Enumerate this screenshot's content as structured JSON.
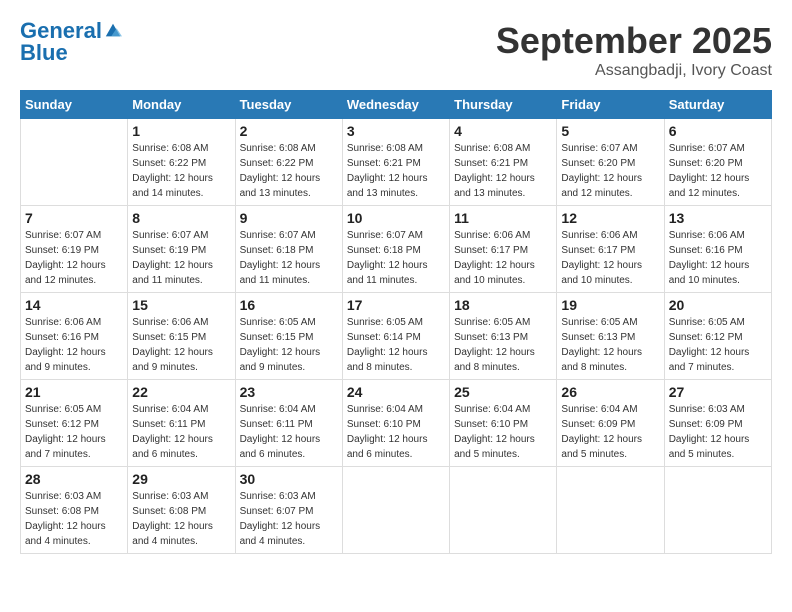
{
  "logo": {
    "line1": "General",
    "line2": "Blue"
  },
  "title": "September 2025",
  "location": "Assangbadji, Ivory Coast",
  "days_header": [
    "Sunday",
    "Monday",
    "Tuesday",
    "Wednesday",
    "Thursday",
    "Friday",
    "Saturday"
  ],
  "weeks": [
    [
      {
        "day": "",
        "info": ""
      },
      {
        "day": "1",
        "info": "Sunrise: 6:08 AM\nSunset: 6:22 PM\nDaylight: 12 hours\nand 14 minutes."
      },
      {
        "day": "2",
        "info": "Sunrise: 6:08 AM\nSunset: 6:22 PM\nDaylight: 12 hours\nand 13 minutes."
      },
      {
        "day": "3",
        "info": "Sunrise: 6:08 AM\nSunset: 6:21 PM\nDaylight: 12 hours\nand 13 minutes."
      },
      {
        "day": "4",
        "info": "Sunrise: 6:08 AM\nSunset: 6:21 PM\nDaylight: 12 hours\nand 13 minutes."
      },
      {
        "day": "5",
        "info": "Sunrise: 6:07 AM\nSunset: 6:20 PM\nDaylight: 12 hours\nand 12 minutes."
      },
      {
        "day": "6",
        "info": "Sunrise: 6:07 AM\nSunset: 6:20 PM\nDaylight: 12 hours\nand 12 minutes."
      }
    ],
    [
      {
        "day": "7",
        "info": "Sunrise: 6:07 AM\nSunset: 6:19 PM\nDaylight: 12 hours\nand 12 minutes."
      },
      {
        "day": "8",
        "info": "Sunrise: 6:07 AM\nSunset: 6:19 PM\nDaylight: 12 hours\nand 11 minutes."
      },
      {
        "day": "9",
        "info": "Sunrise: 6:07 AM\nSunset: 6:18 PM\nDaylight: 12 hours\nand 11 minutes."
      },
      {
        "day": "10",
        "info": "Sunrise: 6:07 AM\nSunset: 6:18 PM\nDaylight: 12 hours\nand 11 minutes."
      },
      {
        "day": "11",
        "info": "Sunrise: 6:06 AM\nSunset: 6:17 PM\nDaylight: 12 hours\nand 10 minutes."
      },
      {
        "day": "12",
        "info": "Sunrise: 6:06 AM\nSunset: 6:17 PM\nDaylight: 12 hours\nand 10 minutes."
      },
      {
        "day": "13",
        "info": "Sunrise: 6:06 AM\nSunset: 6:16 PM\nDaylight: 12 hours\nand 10 minutes."
      }
    ],
    [
      {
        "day": "14",
        "info": "Sunrise: 6:06 AM\nSunset: 6:16 PM\nDaylight: 12 hours\nand 9 minutes."
      },
      {
        "day": "15",
        "info": "Sunrise: 6:06 AM\nSunset: 6:15 PM\nDaylight: 12 hours\nand 9 minutes."
      },
      {
        "day": "16",
        "info": "Sunrise: 6:05 AM\nSunset: 6:15 PM\nDaylight: 12 hours\nand 9 minutes."
      },
      {
        "day": "17",
        "info": "Sunrise: 6:05 AM\nSunset: 6:14 PM\nDaylight: 12 hours\nand 8 minutes."
      },
      {
        "day": "18",
        "info": "Sunrise: 6:05 AM\nSunset: 6:13 PM\nDaylight: 12 hours\nand 8 minutes."
      },
      {
        "day": "19",
        "info": "Sunrise: 6:05 AM\nSunset: 6:13 PM\nDaylight: 12 hours\nand 8 minutes."
      },
      {
        "day": "20",
        "info": "Sunrise: 6:05 AM\nSunset: 6:12 PM\nDaylight: 12 hours\nand 7 minutes."
      }
    ],
    [
      {
        "day": "21",
        "info": "Sunrise: 6:05 AM\nSunset: 6:12 PM\nDaylight: 12 hours\nand 7 minutes."
      },
      {
        "day": "22",
        "info": "Sunrise: 6:04 AM\nSunset: 6:11 PM\nDaylight: 12 hours\nand 6 minutes."
      },
      {
        "day": "23",
        "info": "Sunrise: 6:04 AM\nSunset: 6:11 PM\nDaylight: 12 hours\nand 6 minutes."
      },
      {
        "day": "24",
        "info": "Sunrise: 6:04 AM\nSunset: 6:10 PM\nDaylight: 12 hours\nand 6 minutes."
      },
      {
        "day": "25",
        "info": "Sunrise: 6:04 AM\nSunset: 6:10 PM\nDaylight: 12 hours\nand 5 minutes."
      },
      {
        "day": "26",
        "info": "Sunrise: 6:04 AM\nSunset: 6:09 PM\nDaylight: 12 hours\nand 5 minutes."
      },
      {
        "day": "27",
        "info": "Sunrise: 6:03 AM\nSunset: 6:09 PM\nDaylight: 12 hours\nand 5 minutes."
      }
    ],
    [
      {
        "day": "28",
        "info": "Sunrise: 6:03 AM\nSunset: 6:08 PM\nDaylight: 12 hours\nand 4 minutes."
      },
      {
        "day": "29",
        "info": "Sunrise: 6:03 AM\nSunset: 6:08 PM\nDaylight: 12 hours\nand 4 minutes."
      },
      {
        "day": "30",
        "info": "Sunrise: 6:03 AM\nSunset: 6:07 PM\nDaylight: 12 hours\nand 4 minutes."
      },
      {
        "day": "",
        "info": ""
      },
      {
        "day": "",
        "info": ""
      },
      {
        "day": "",
        "info": ""
      },
      {
        "day": "",
        "info": ""
      }
    ]
  ]
}
